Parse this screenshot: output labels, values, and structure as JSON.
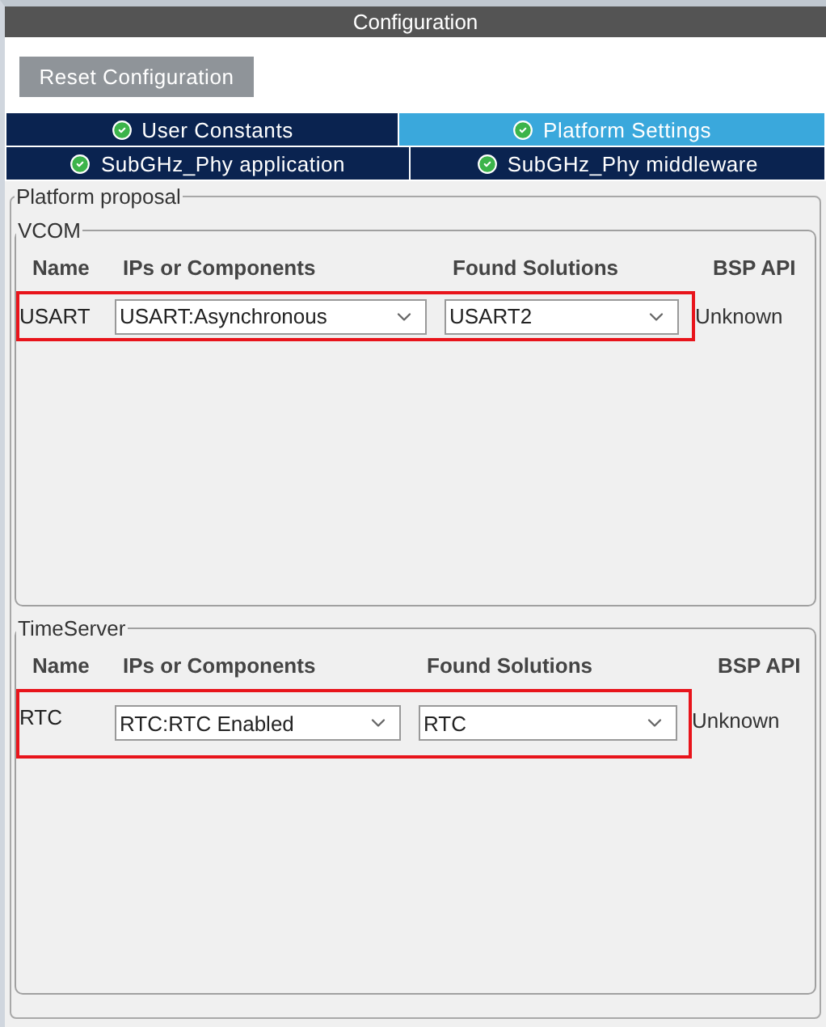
{
  "title": "Configuration",
  "reset_button": "Reset Configuration",
  "tab_rows": [
    [
      {
        "label": "User Constants",
        "selected": false
      },
      {
        "label": "Platform Settings",
        "selected": true
      }
    ],
    [
      {
        "label": "SubGHz_Phy application",
        "selected": false
      },
      {
        "label": "SubGHz_Phy middleware",
        "selected": false
      }
    ]
  ],
  "platform_proposal": {
    "legend": "Platform proposal",
    "groups": [
      {
        "legend": "VCOM",
        "columns": [
          "Name",
          "IPs or Components",
          "Found Solutions",
          "BSP API"
        ],
        "rows": [
          {
            "name": "USART",
            "ip": "USART:Asynchronous",
            "solution": "USART2",
            "bsp_api": "Unknown",
            "highlighted": true
          }
        ]
      },
      {
        "legend": "TimeServer",
        "columns": [
          "Name",
          "IPs or Components",
          "Found Solutions",
          "BSP API"
        ],
        "rows": [
          {
            "name": "RTC",
            "ip": "RTC:RTC Enabled",
            "solution": "RTC",
            "bsp_api": "Unknown",
            "highlighted": true
          }
        ]
      }
    ]
  }
}
